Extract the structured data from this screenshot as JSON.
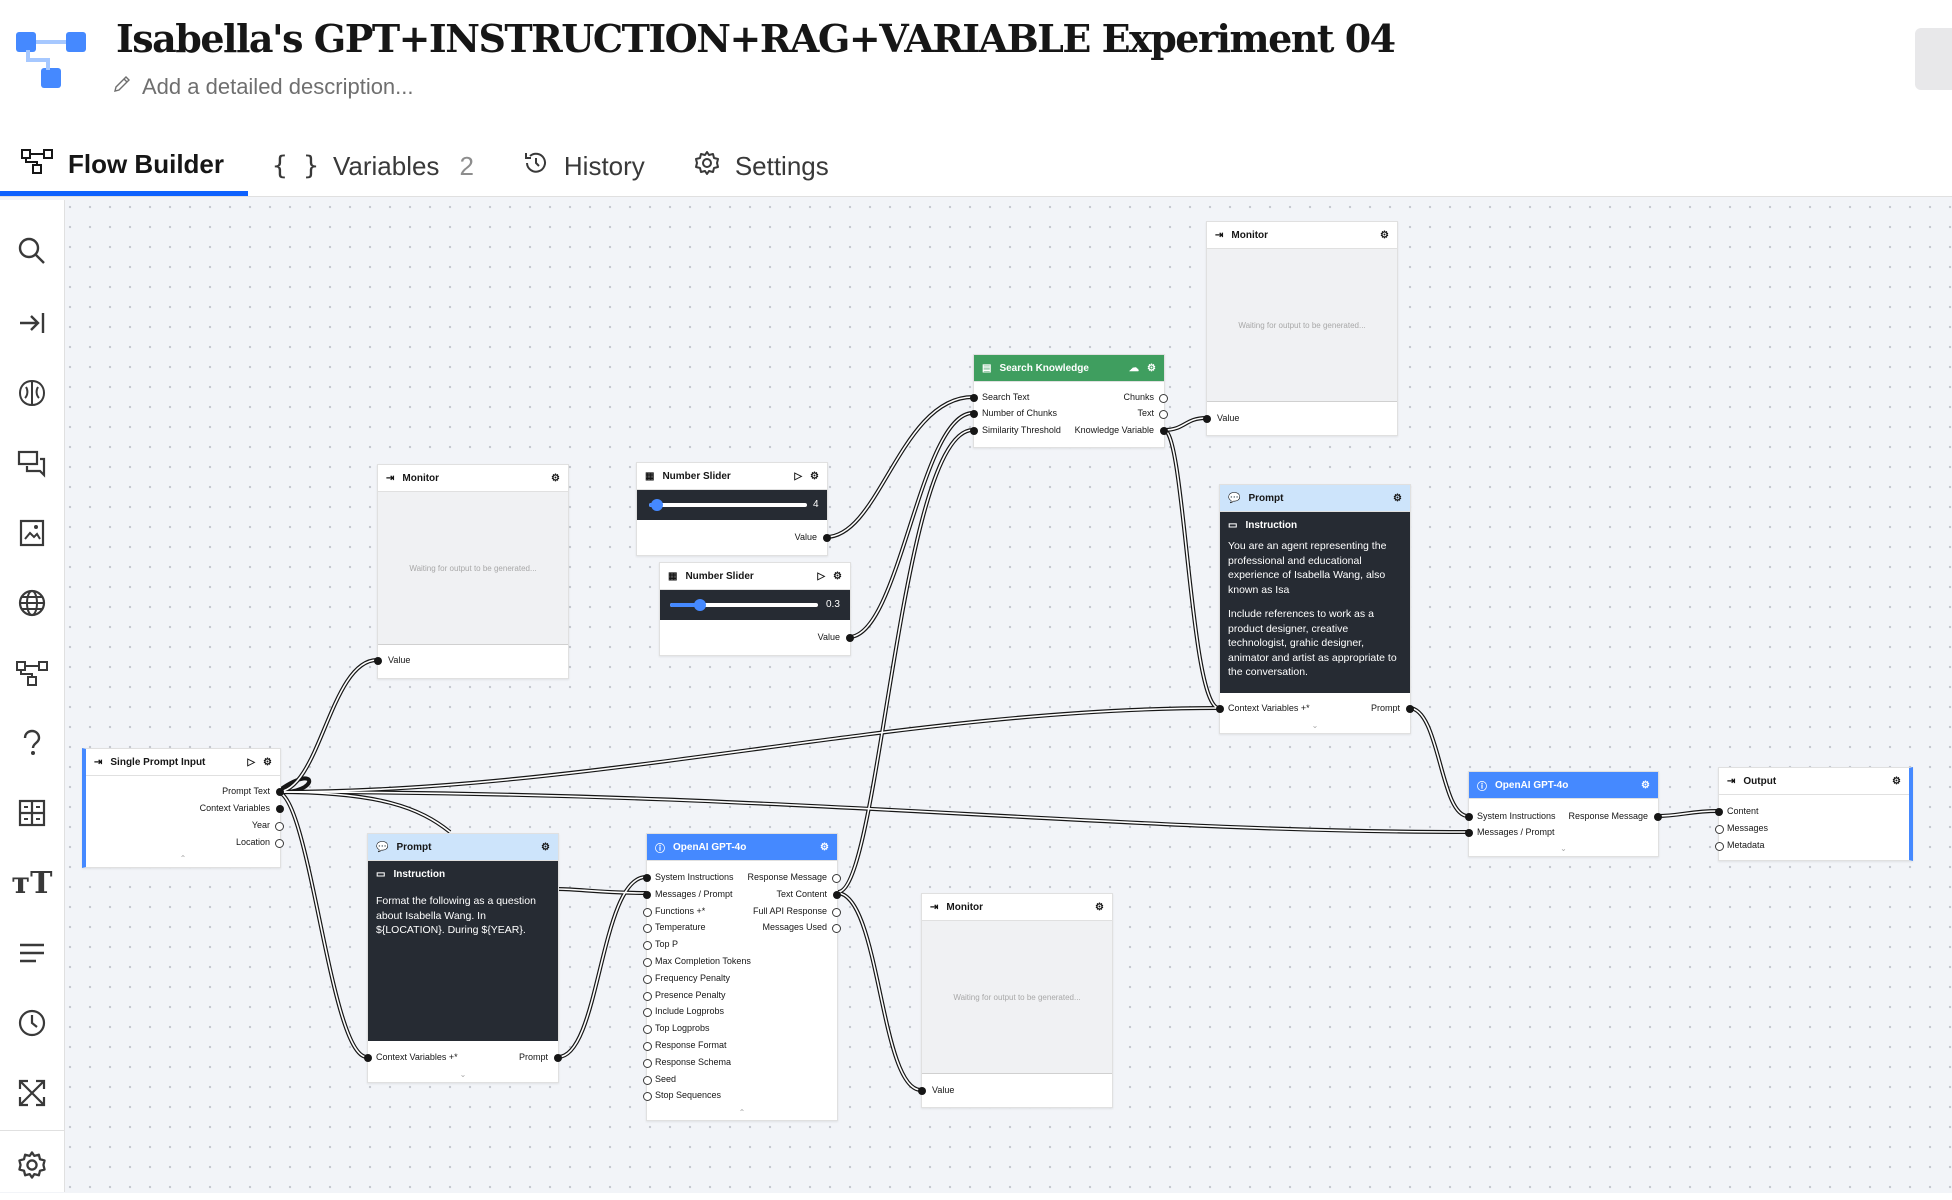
{
  "app": {
    "title": "Isabella's GPT+INSTRUCTION+RAG+VARIABLE Experiment 04",
    "description_placeholder": "Add a detailed description..."
  },
  "tabs": [
    {
      "label": "Flow Builder",
      "active": true
    },
    {
      "label": "Variables",
      "count": "2"
    },
    {
      "label": "History"
    },
    {
      "label": "Settings"
    }
  ],
  "toolbar_icons": [
    "search-icon",
    "input-icon",
    "brain-icon",
    "chat-icon",
    "image-icon",
    "globe-icon",
    "flow-icon",
    "help-icon",
    "grid-icon",
    "text-size-icon",
    "lines-icon",
    "clock-icon",
    "expand-icon",
    "settings-icon"
  ],
  "colors": {
    "accent": "#0f62fe",
    "gpt_header": "#4589ff",
    "prompt_header": "#cde4fb",
    "knowledge_header": "#3f9e5f",
    "instruction_bg": "#262b33"
  },
  "nodes": {
    "monitor_top": {
      "title": "Monitor",
      "waiting": "Waiting for output to be generated...",
      "value": "Value"
    },
    "search_knowledge": {
      "title": "Search Knowledge",
      "in_search": "Search Text",
      "in_chunks": "Number of Chunks",
      "in_sim": "Similarity Threshold",
      "out_chunks": "Chunks",
      "out_text": "Text",
      "out_kv": "Knowledge Variable"
    },
    "monitor_left": {
      "title": "Monitor",
      "waiting": "Waiting for output to be generated...",
      "value": "Value"
    },
    "slider1": {
      "title": "Number Slider",
      "value": "4",
      "out": "Value",
      "level": 0.05
    },
    "slider2": {
      "title": "Number Slider",
      "value": "0.3",
      "out": "Value",
      "level": 0.2
    },
    "prompt_right": {
      "title": "Prompt",
      "instruction": "Instruction",
      "text1": "You are an agent representing the professional and educational experience of Isabella Wang, also known as Isa",
      "text2": "Include references to work as a product designer, creative technologist, grahic designer, animator and artist as appropriate to the conversation.",
      "ctx": "Context Variables +*",
      "out": "Prompt"
    },
    "single_prompt": {
      "title": "Single Prompt Input",
      "out_prompt": "Prompt Text",
      "out_ctx": "Context Variables",
      "out_year": "Year",
      "out_loc": "Location"
    },
    "prompt_left": {
      "title": "Prompt",
      "instruction": "Instruction",
      "text": "Format the following as a question about Isabella Wang. In ${LOCATION}. During ${YEAR}.",
      "ctx": "Context Variables +*",
      "out": "Prompt"
    },
    "gpt_left": {
      "title": "OpenAI GPT-4o",
      "inputs": [
        "System Instructions",
        "Messages / Prompt",
        "Functions +*",
        "Temperature",
        "Top P",
        "Max Completion Tokens",
        "Frequency Penalty",
        "Presence Penalty",
        "Include Logprobs",
        "Top Logprobs",
        "Response Format",
        "Response Schema",
        "Seed",
        "Stop Sequences"
      ],
      "outputs": [
        "Response Message",
        "Text Content",
        "Full API Response",
        "Messages Used"
      ]
    },
    "monitor_bottom": {
      "title": "Monitor",
      "waiting": "Waiting for output to be generated...",
      "value": "Value"
    },
    "gpt_right": {
      "title": "OpenAI GPT-4o",
      "in_sys": "System Instructions",
      "in_msg": "Messages / Prompt",
      "out": "Response Message"
    },
    "output": {
      "title": "Output",
      "content": "Content",
      "messages": "Messages",
      "metadata": "Metadata"
    }
  }
}
